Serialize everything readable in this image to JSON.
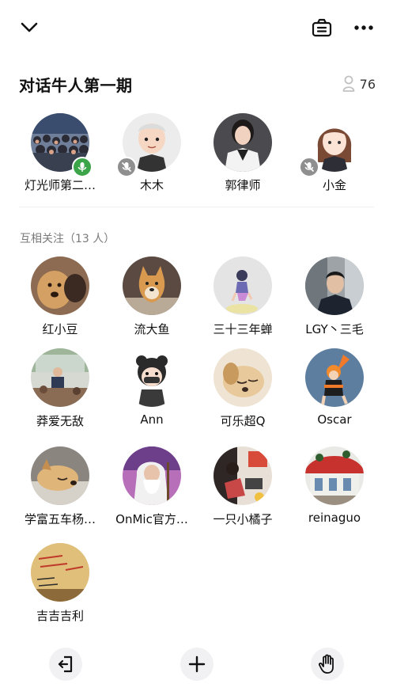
{
  "header": {
    "collapse_icon": "chevron-down-icon",
    "doc_icon": "notice-board-icon",
    "more_icon": "more-dots-icon"
  },
  "room": {
    "title": "对话牛人第一期",
    "listener_count": "76"
  },
  "speakers": [
    {
      "name": "灯光师第二…",
      "mic": "on"
    },
    {
      "name": "木木",
      "mic": "off"
    },
    {
      "name": "郭律师",
      "mic": "none"
    },
    {
      "name": "小金",
      "mic": "off"
    }
  ],
  "following": {
    "section_title": "互相关注（13 人）",
    "members": [
      {
        "name": "红小豆"
      },
      {
        "name": "流大鱼"
      },
      {
        "name": "三十三年蝉"
      },
      {
        "name": "LGY丶三毛"
      },
      {
        "name": "莽爱无敌"
      },
      {
        "name": "Ann"
      },
      {
        "name": "可乐超Q"
      },
      {
        "name": "Oscar"
      },
      {
        "name": "学富五车杨…"
      },
      {
        "name": "OnMic官方…"
      },
      {
        "name": "一只小橘子"
      },
      {
        "name": "reinaguo"
      },
      {
        "name": "吉吉吉利"
      }
    ]
  },
  "bottom": {
    "leave_icon": "exit-icon",
    "add_icon": "plus-icon",
    "raise_hand_icon": "raise-hand-icon"
  }
}
